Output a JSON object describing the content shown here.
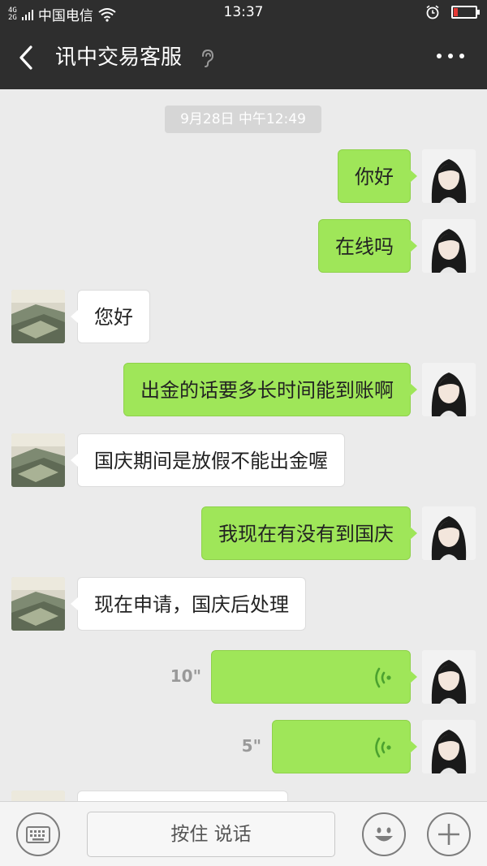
{
  "status_bar": {
    "network_type": "4G",
    "network_type_2": "2G",
    "carrier": "中国电信",
    "time": "13:37"
  },
  "header": {
    "title": "讯中交易客服",
    "back_icon": "chevron-left-icon",
    "earpiece_icon": "ear-icon",
    "more_icon": "more-dots-icon"
  },
  "chat": {
    "timestamp": "9月28日 中午12:49",
    "messages": [
      {
        "from": "me",
        "text": "你好"
      },
      {
        "from": "me",
        "text": "在线吗"
      },
      {
        "from": "them",
        "text": "您好"
      },
      {
        "from": "me",
        "text": "出金的话要多长时间能到账啊"
      },
      {
        "from": "them",
        "text": "国庆期间是放假不能出金喔"
      },
      {
        "from": "me",
        "text": "我现在有没有到国庆"
      },
      {
        "from": "them",
        "text": "现在申请，国庆后处理"
      },
      {
        "from": "me",
        "type": "voice",
        "duration": "10\""
      },
      {
        "from": "me",
        "type": "voice",
        "duration": "5\""
      }
    ]
  },
  "input_bar": {
    "talk_label": "按住 说话",
    "keyboard_icon": "keyboard-icon",
    "emoji_icon": "emoji-icon",
    "plus_icon": "plus-icon"
  },
  "colors": {
    "header_bg": "#2e2e2e",
    "chat_bg": "#ebebeb",
    "my_bubble": "#9fe659",
    "their_bubble": "#ffffff",
    "voice_wave": "#4ca22f"
  }
}
